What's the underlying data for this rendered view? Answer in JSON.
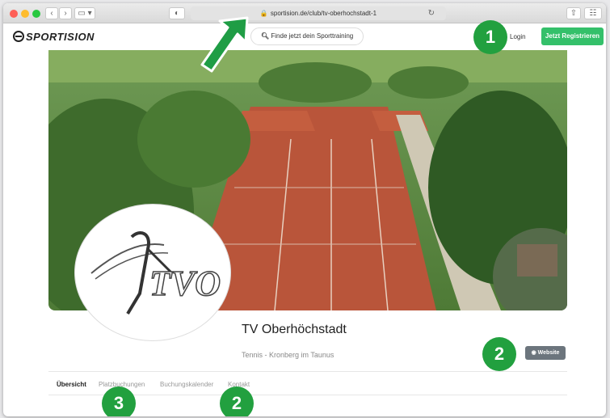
{
  "browser": {
    "url": "sportision.de/club/tv-oberhochstadt-1"
  },
  "header": {
    "logo_text": "SPORTISION",
    "search_label": "Finde jetzt dein Sporttraining",
    "login_label": "Login",
    "register_label": "Jetzt Registrieren"
  },
  "club": {
    "logo_text": "TVO",
    "name": "TV Oberhöchstadt",
    "subtitle": "Tennis - Kronberg im Taunus",
    "website_label": "Website"
  },
  "tabs": [
    {
      "label": "Übersicht",
      "active": true
    },
    {
      "label": "Platzbuchungen",
      "active": false
    },
    {
      "label": "Buchungskalender",
      "active": false
    },
    {
      "label": "Kontakt",
      "active": false
    }
  ],
  "annotations": {
    "badge_login": "1",
    "badge_website": "2",
    "badge_platz": "3",
    "badge_kontakt": "2"
  },
  "colors": {
    "brand_green": "#34c06a",
    "badge_green": "#22a03f",
    "arrow_green": "#1f9d45"
  }
}
